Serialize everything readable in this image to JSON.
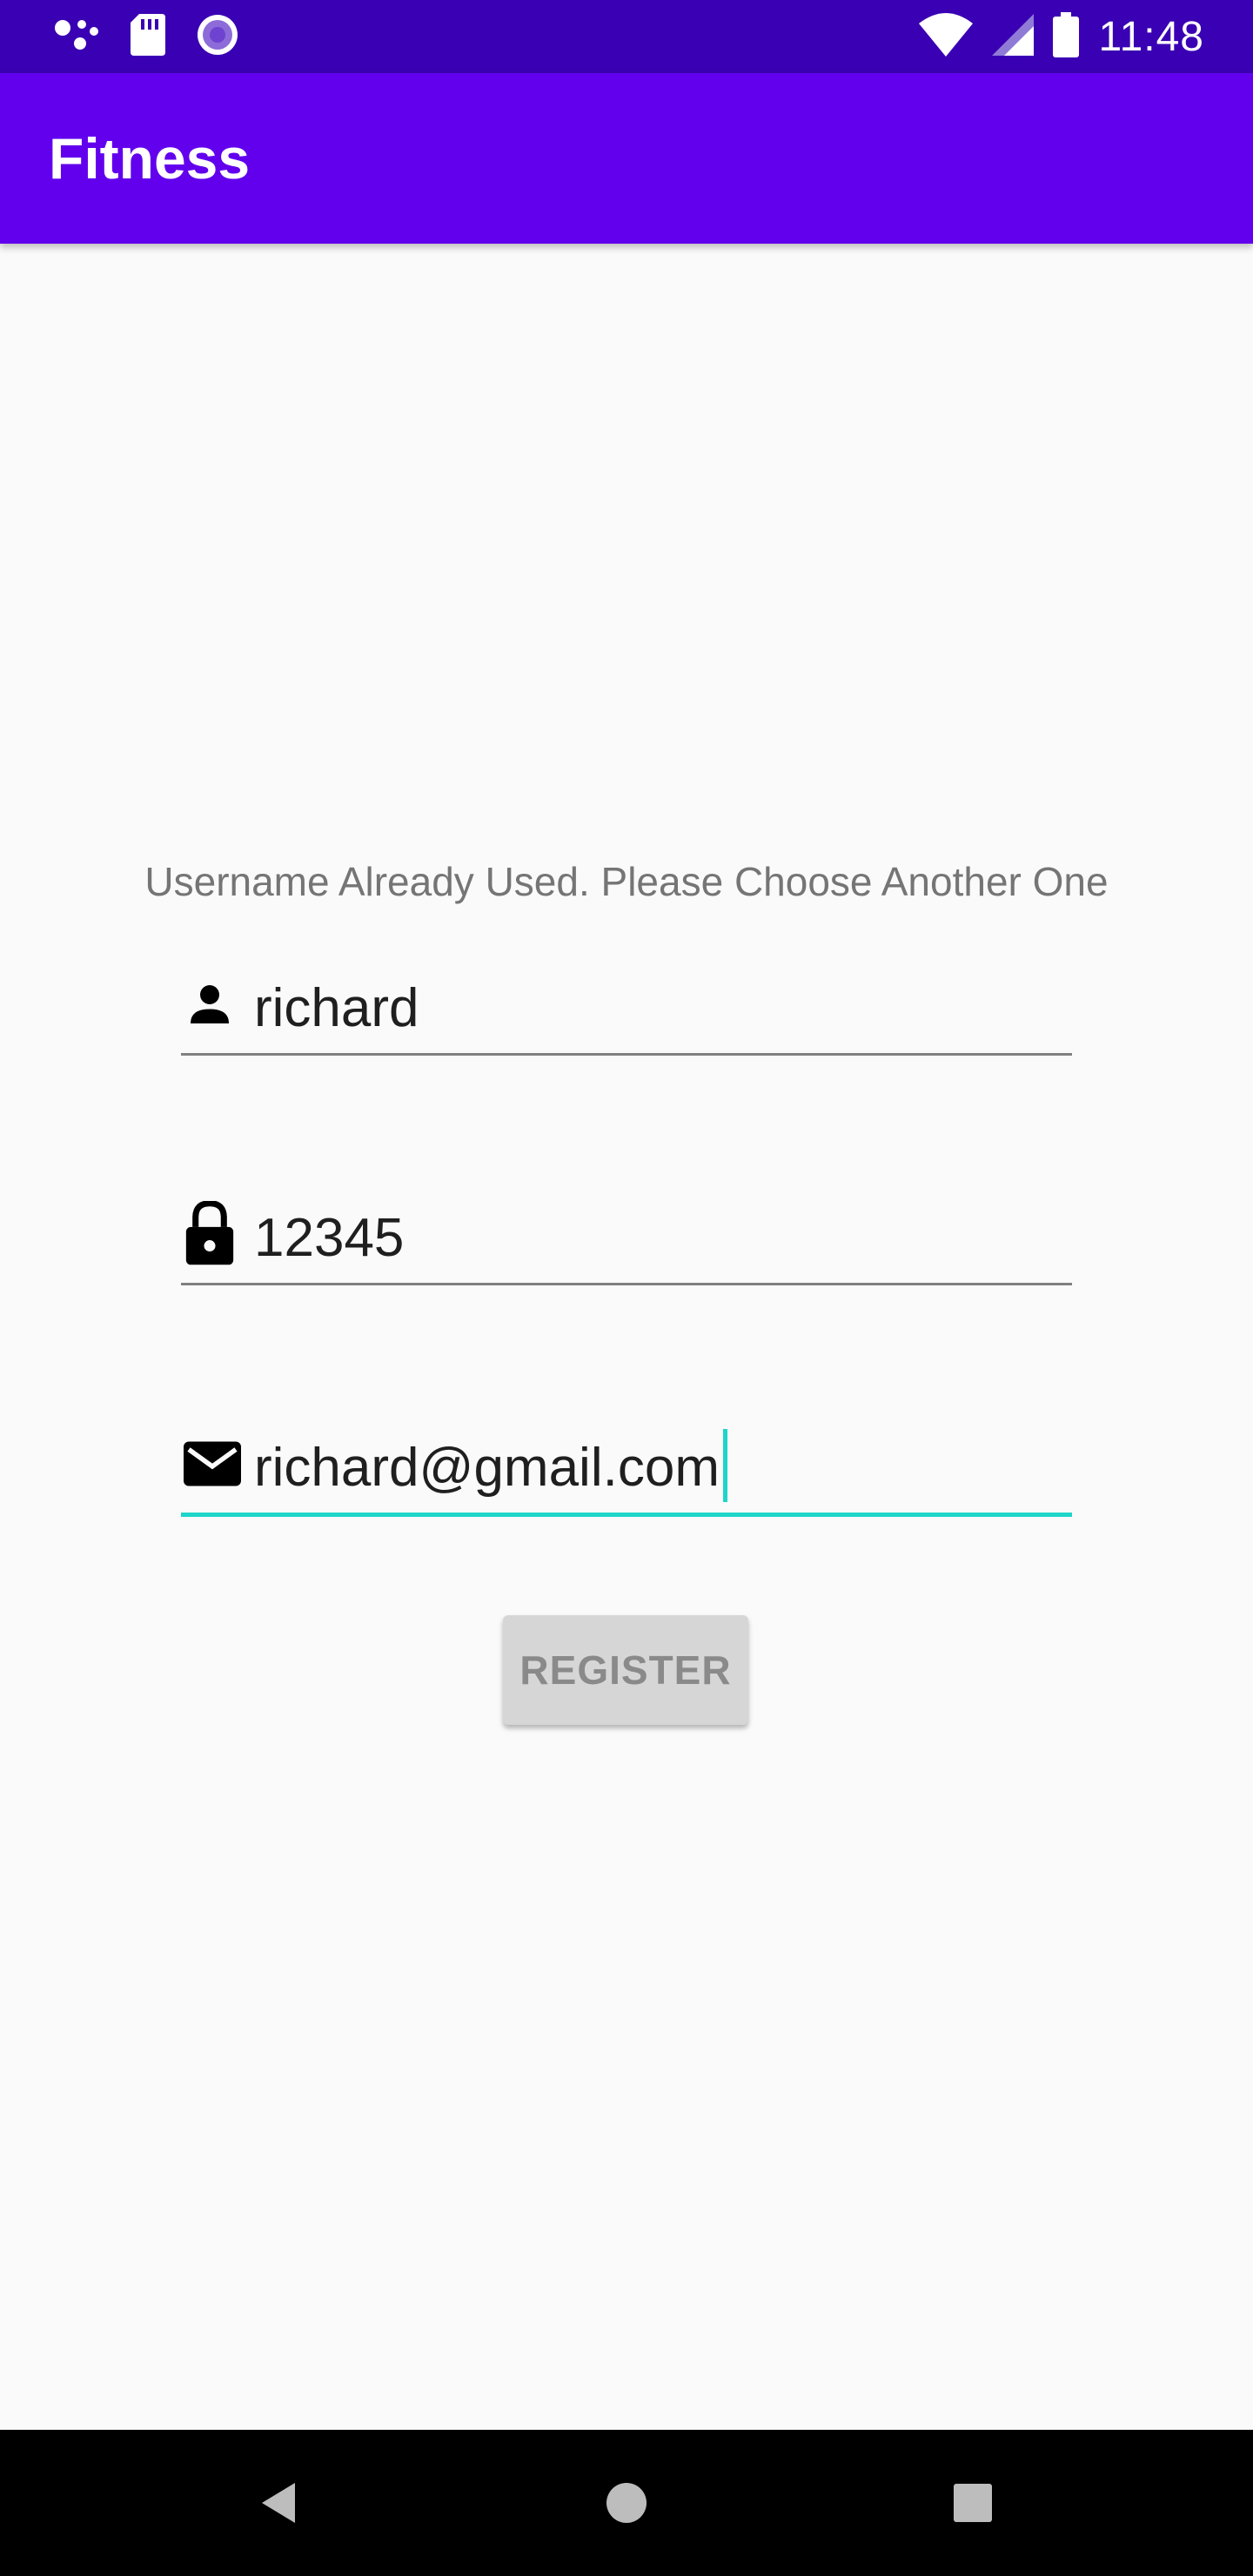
{
  "status_bar": {
    "time": "11:48",
    "left_icons": [
      "assistant-dots-icon",
      "sd-card-icon",
      "sync-circle-icon"
    ],
    "right_icons": [
      "wifi-icon",
      "cell-signal-icon",
      "battery-icon"
    ]
  },
  "app_bar": {
    "title": "Fitness"
  },
  "form": {
    "error_message": "Username Already Used. Please Choose Another One",
    "username": {
      "value": "richard",
      "icon": "person-icon"
    },
    "password": {
      "value": "12345",
      "icon": "lock-icon"
    },
    "email": {
      "value": "richard@gmail.com",
      "icon": "mail-icon",
      "focused": true
    },
    "register_label": "REGISTER"
  },
  "colors": {
    "status_bar": "#3a00b3",
    "app_bar": "#6200ee",
    "accent": "#1ed5c9",
    "button_bg": "#d6d6d6",
    "button_text": "#8a8a8a"
  },
  "nav_bar": {
    "items": [
      "back-icon",
      "home-icon",
      "recents-icon"
    ]
  }
}
